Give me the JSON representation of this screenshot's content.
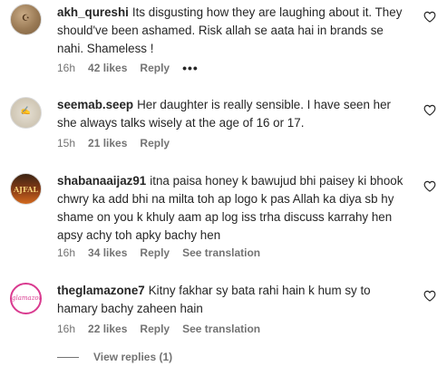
{
  "comments": [
    {
      "username": "akh_qureshi",
      "text": "Its disgusting how they are laughing about it. They should've been ashamed. Risk allah se aata hai in brands se nahi. Shameless !",
      "time": "16h",
      "likes": "42 likes",
      "reply": "Reply",
      "more": "•••",
      "avatar_text": "☪"
    },
    {
      "username": "seemab.seep",
      "text": "Her daughter is really sensible. I have seen her she always talks wisely at the age of 16 or 17.",
      "time": "15h",
      "likes": "21 likes",
      "reply": "Reply",
      "avatar_text": "✍"
    },
    {
      "username": "shabanaaijaz91",
      "text": "itna paisa honey k bawujud bhi paisey ki bhook chwry ka add bhi na milta toh ap logo k pas Allah ka diya sb hy shame on you k khuly aam ap log iss trha discuss karrahy hen apsy achy toh apky bachy hen",
      "time": "16h",
      "likes": "34 likes",
      "reply": "Reply",
      "see_translation": "See translation",
      "avatar_text": "AJFAL"
    },
    {
      "username": "theglamazone7",
      "text": "Kitny fakhar sy bata rahi hain k hum sy to hamary bachy zaheen hain",
      "time": "16h",
      "likes": "22 likes",
      "reply": "Reply",
      "see_translation": "See translation",
      "avatar_text": "glamazone"
    }
  ],
  "view_replies": "View replies (1)",
  "icons": {
    "like": "heart-outline-icon"
  },
  "colors": {
    "text": "#262626",
    "secondary": "#737373"
  }
}
